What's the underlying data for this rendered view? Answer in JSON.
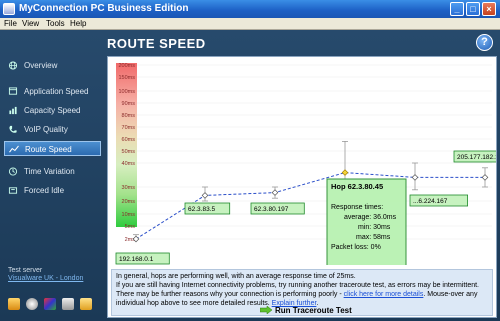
{
  "window": {
    "title": "MyConnection PC Business Edition"
  },
  "menu": [
    "File",
    "View",
    "Tools",
    "Help"
  ],
  "header": {
    "title": "ROUTE SPEED",
    "help_label": "?"
  },
  "sidebar": {
    "items": [
      {
        "label": "Overview",
        "icon": "globe-icon",
        "active": false
      },
      {
        "label": "Application Speed",
        "icon": "application-icon",
        "active": false
      },
      {
        "label": "Capacity Speed",
        "icon": "capacity-icon",
        "active": false
      },
      {
        "label": "VoIP Quality",
        "icon": "voip-icon",
        "active": false
      },
      {
        "label": "Route Speed",
        "icon": "route-icon",
        "active": true
      },
      {
        "label": "Time Variation",
        "icon": "clock-icon",
        "active": false
      },
      {
        "label": "Forced Idle",
        "icon": "idle-icon",
        "active": false
      }
    ],
    "test_server_label": "Test server",
    "test_server_value": "Visualware UK - London"
  },
  "chart_data": {
    "type": "line",
    "y_ticks": [
      "200ms",
      "150ms",
      "100ms",
      "90ms",
      "80ms",
      "70ms",
      "60ms",
      "50ms",
      "40ms",
      "30ms",
      "20ms",
      "10ms",
      "5ms",
      "2ms"
    ],
    "hops": [
      {
        "label": "192.168.0.1",
        "avg": 2,
        "min": 1,
        "max": 3
      },
      {
        "label": "62.3.83.5",
        "avg": 24,
        "min": 20,
        "max": 30
      },
      {
        "label": "62.3.80.197",
        "avg": 26,
        "min": 22,
        "max": 30
      },
      {
        "label": "62.3.80.45",
        "avg": 36,
        "min": 30,
        "max": 58
      },
      {
        "label": "205.177.182.164",
        "avg": 34,
        "min": 28,
        "max": 40
      },
      {
        "label": "205.177.182.164",
        "avg": 34,
        "min": 30,
        "max": 38
      }
    ],
    "hop_labels_shown": [
      "192.168.0.1",
      "62.3.83.5",
      "62.3.80.197",
      "...6.224.167",
      "205.177.182.164"
    ],
    "tooltip": {
      "title": "Hop 62.3.80.45",
      "response_label": "Response times:",
      "average": "average: 36.0ms",
      "min": "min: 30ms",
      "max": "max: 58ms",
      "packet_loss": "Packet loss: 0%"
    },
    "colors": {
      "line": "#2b4fc9",
      "label_bg": "#c7f2c0",
      "label_border": "#1f8a2b"
    }
  },
  "info": {
    "line1": "In general, hops are performing well, with an average response time of 25ms.",
    "line2": "If you are still having Internet connectivity problems, try running another traceroute test, as errors may be intermittent.",
    "line3a": "There may be further reasons why your connection is performing poorly - ",
    "line3_link": "click here for more details",
    "line3b": ". Mouse-over any",
    "line4a": "individual hop above to see more detailed results. ",
    "line4_link": "Explain further",
    "line4b": ".",
    "run_button": "Run Traceroute Test"
  }
}
